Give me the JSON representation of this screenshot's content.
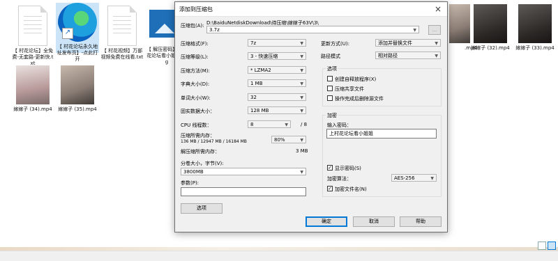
{
  "explorer": {
    "files": [
      {
        "name": "【 村花论坛】全免费-无套路-更新快.txt",
        "type": "txt"
      },
      {
        "name": "【 村花论坛永久地址发布页】-点此打开",
        "type": "link"
      },
      {
        "name": "【 村花视频】万部视频免费在线看.txt",
        "type": "txt"
      },
      {
        "name": "【 解压密码】上村花论坛看小姐姐.jpg",
        "type": "jpg"
      },
      {
        "name": "嫁嫁子 (32).mp4",
        "type": "mp4"
      },
      {
        "name": "嫁嫁子 (33).mp4",
        "type": "mp4"
      },
      {
        "name": "嫁嫁子 (34).mp4",
        "type": "mp4"
      },
      {
        "name": "嫁嫁子 (35).mp4",
        "type": "mp4"
      },
      {
        "name": ".mp4",
        "type": "mp4"
      }
    ]
  },
  "dialog": {
    "title": "添加到压缩包",
    "close_icon": "×",
    "archive_label": "压缩包(A):",
    "archive_path": "D:\\BaiduNetdiskDownload\\待压缩\\嫁嫁子63V\\3\\",
    "archive_name": "3.7z",
    "browse_label": "...",
    "format_label": "压缩格式(F):",
    "format_value": "7z",
    "level_label": "压缩等级(L):",
    "level_value": "3 - 快速压缩",
    "method_label": "压缩方法(M):",
    "method_value": "* LZMA2",
    "dict_label": "字典大小(D):",
    "dict_value": "1 MB",
    "word_label": "单词大小(W):",
    "word_value": "32",
    "solid_label": "固实数据大小：",
    "solid_value": "128 MB",
    "cpu_label": "CPU 线程数：",
    "cpu_value": "8",
    "cpu_total": "/ 8",
    "mem_label": "压缩所需内存：",
    "mem_value": "136 MB / 12947 MB / 16184 MB",
    "mem_percent": "80%",
    "decomp_label": "解压缩所需内存：",
    "decomp_value": "3 MB",
    "split_label": "分卷大小，字节(V):",
    "split_value": "3800MB",
    "params_label": "参数(P):",
    "params_value": "",
    "options_button": "选项",
    "update_label": "更新方式(U):",
    "update_value": "添加并替换文件",
    "path_label": "路径模式",
    "path_value": "相对路径",
    "options_group": "选项",
    "opt_sfx": "创建自释放程序(X)",
    "opt_shared": "压缩共享文件",
    "opt_delete": "操作完成后删除源文件",
    "enc_group": "加密",
    "password_label": "输入密码：",
    "password_value": "上村花论坛看小姐姐",
    "show_password": "显示密码(S)",
    "enc_method_label": "加密算法：",
    "enc_method_value": "AES-256",
    "enc_names": "加密文件名(N)",
    "ok_button": "确定",
    "cancel_button": "取消",
    "help_button": "帮助"
  }
}
